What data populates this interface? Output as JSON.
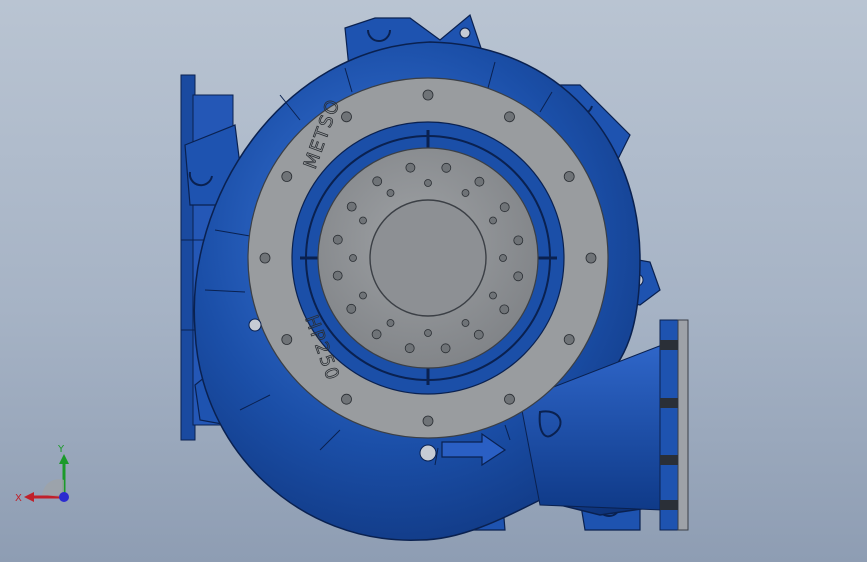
{
  "viewport": {
    "background_top": "#b9c4d2",
    "background_bottom": "#8e9db3"
  },
  "model": {
    "body_color": "#1b4fa8",
    "body_dark": "#0c2f73",
    "plate_color": "#8d9094",
    "plate_light": "#a5a8ab",
    "ring_color": "#999c9f",
    "engraved_brand_ring": "METSO",
    "engraved_model_ring": "HP250",
    "casting_logo": "metso"
  },
  "triad": {
    "x_label": "X",
    "y_label": "Y",
    "x_color": "#c0202a",
    "y_color": "#1b9a2a",
    "z_color": "#2b2bd0"
  }
}
